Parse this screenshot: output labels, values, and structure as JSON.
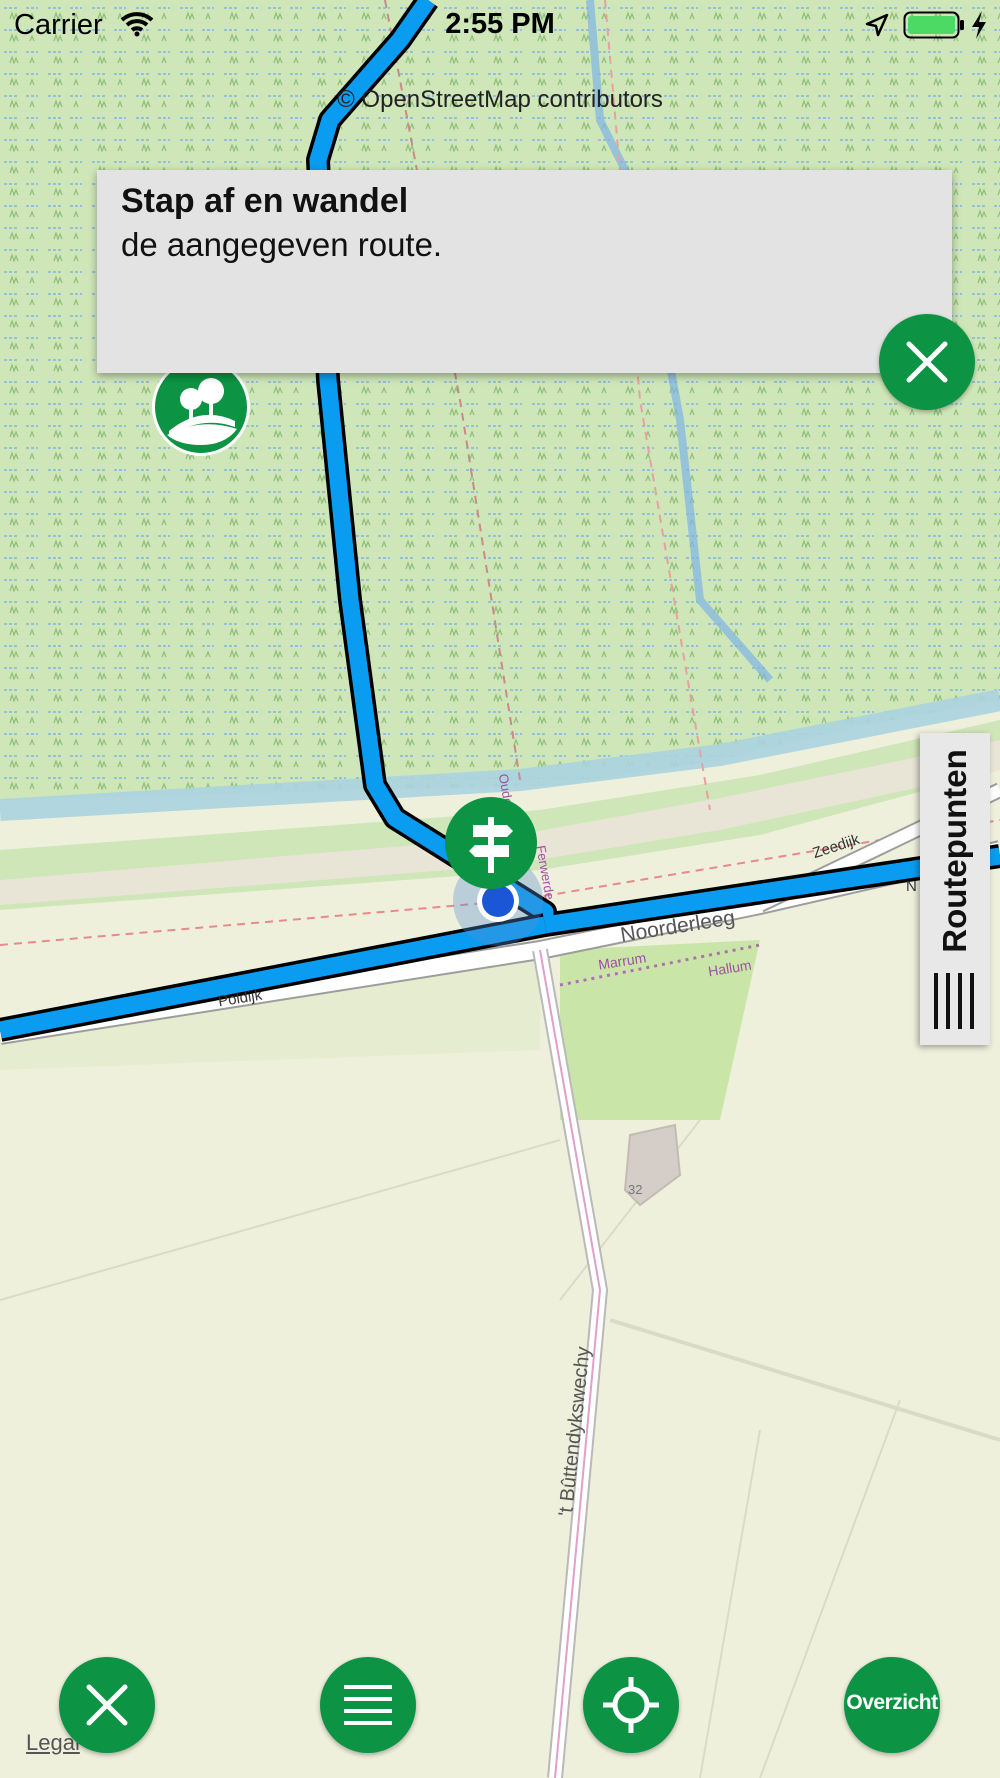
{
  "status_bar": {
    "carrier": "Carrier",
    "time": "2:55 PM",
    "wifi_icon": "wifi-icon",
    "location_icon": "location-arrow-icon",
    "battery_icon": "battery-full-icon",
    "charging_icon": "charging-bolt-icon"
  },
  "map": {
    "attribution": "© OpenStreetMap contributors",
    "legal_link": "Legal",
    "street_labels": {
      "noorderleeg": "Noorderleeg",
      "zeedijk": "Zeedijk",
      "poldijk": "Poldijk",
      "marrum": "Marrum",
      "hallum": "Hallum",
      "buttendykswechy": "'t Bûttendykswechy",
      "ferwerde": "Ferwerde",
      "oude": "Oude",
      "house_number": "32",
      "edge_label": "N"
    },
    "colors": {
      "route": "#0a9cf0",
      "marsh": "#cfe6b8",
      "farmland": "#eef0dc",
      "water": "#aad3df",
      "accent_green": "#0c9444",
      "user_location": "#1a56d6"
    },
    "poi_icons": [
      "nature-park-icon",
      "signpost-icon"
    ],
    "user_location_icon": "user-location-dot-icon"
  },
  "popup": {
    "title": "Stap af en wandel",
    "body": "de aangegeven route.",
    "close_icon": "close-icon"
  },
  "side_tab": {
    "label": "Routepunten",
    "handle_icon": "drag-handle-icon"
  },
  "bottom_bar": {
    "stop_icon": "close-icon",
    "menu_icon": "menu-icon",
    "locate_icon": "crosshair-icon",
    "overview_label": "Overzicht"
  }
}
